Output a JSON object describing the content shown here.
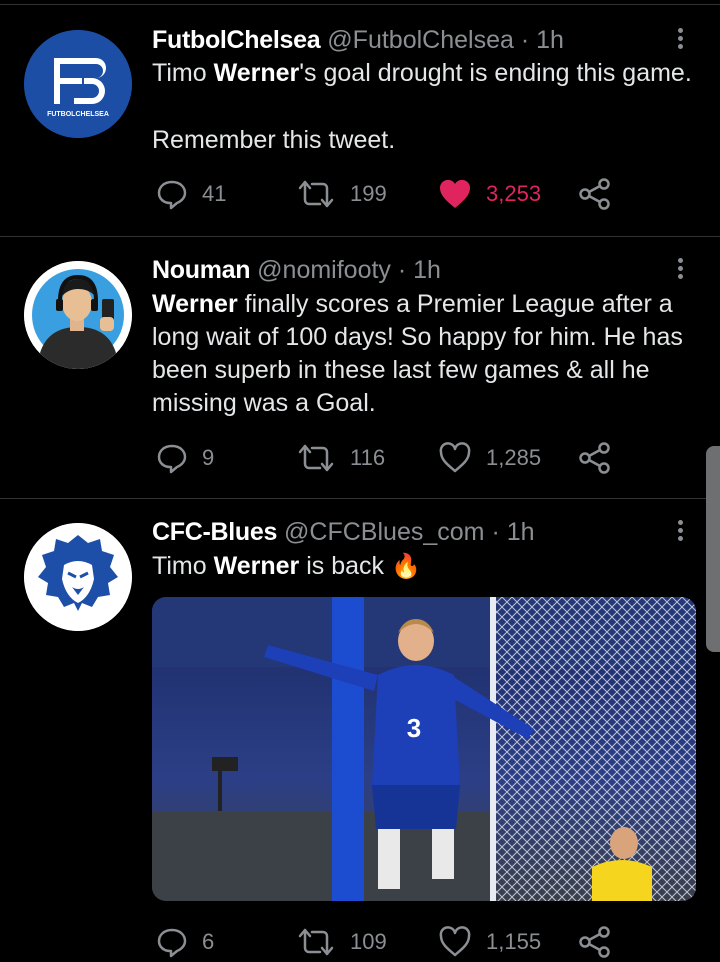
{
  "tweets": [
    {
      "name": "FutbolChelsea",
      "handle": "@FutbolChelsea",
      "sep": "·",
      "time": "1h",
      "text_parts": [
        "Timo ",
        "Werner",
        "'s goal drought is ending this game."
      ],
      "text_line2": "Remember this tweet.",
      "avatar_text": "FUTBOLCHELSEA",
      "avatar_logo": "F3",
      "replies": "41",
      "retweets": "199",
      "likes": "3,253",
      "liked": true
    },
    {
      "name": "Nouman",
      "handle": "@nomifooty",
      "sep": "·",
      "time": "1h",
      "text_bold": "Werner",
      "text_rest": " finally scores a Premier League after a long wait of 100 days! So happy for him. He has been superb in these last few games & all he missing was a Goal.",
      "replies": "9",
      "retweets": "116",
      "likes": "1,285",
      "liked": false
    },
    {
      "name": "CFC-Blues",
      "handle": "@CFCBlues_com",
      "sep": "·",
      "time": "1h",
      "text_parts": [
        "Timo ",
        "Werner",
        " is back "
      ],
      "emoji": "🔥",
      "media_caption": "",
      "replies": "6",
      "retweets": "109",
      "likes": "1,155",
      "liked": false
    }
  ],
  "colors": {
    "background": "#000000",
    "like": "#e0245e",
    "muted": "#8b8f93",
    "chelsea_blue": "#1e4fa8"
  }
}
